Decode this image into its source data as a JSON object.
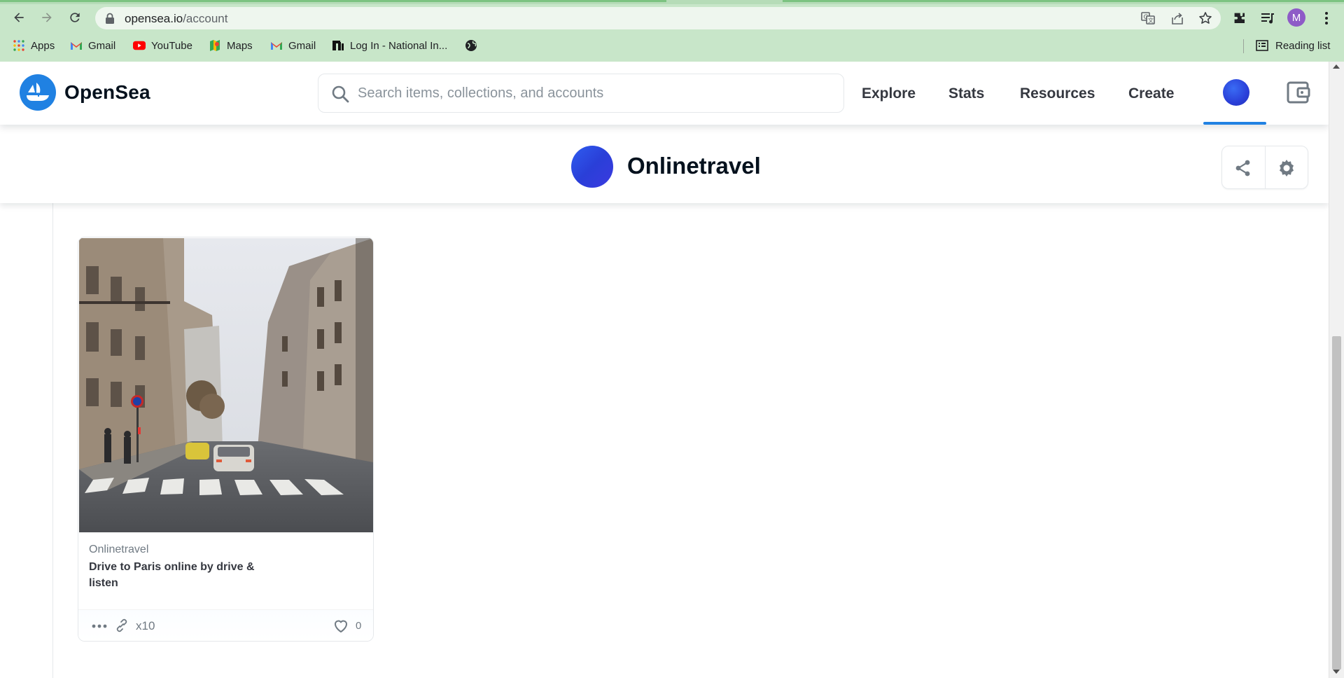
{
  "browser": {
    "url_host": "opensea.io",
    "url_path": "/account",
    "bookmarks": [
      {
        "label": "Apps",
        "icon": "apps-grid-icon"
      },
      {
        "label": "Gmail",
        "icon": "gmail-icon"
      },
      {
        "label": "YouTube",
        "icon": "youtube-icon"
      },
      {
        "label": "Maps",
        "icon": "maps-icon"
      },
      {
        "label": "Gmail",
        "icon": "gmail-icon"
      },
      {
        "label": "Log In - National In...",
        "icon": "national-instruments-icon"
      },
      {
        "label": "",
        "icon": "globe-icon"
      }
    ],
    "reading_list_label": "Reading list",
    "profile_initial": "M"
  },
  "header": {
    "brand": "OpenSea",
    "search_placeholder": "Search items, collections, and accounts",
    "nav": [
      "Explore",
      "Stats",
      "Resources",
      "Create"
    ],
    "accent_color": "#2081e2"
  },
  "profile": {
    "name": "Onlinetravel"
  },
  "items": [
    {
      "collection": "Onlinetravel",
      "title": "Drive to Paris online by drive & listen",
      "quantity": "x10",
      "likes": "0"
    }
  ]
}
